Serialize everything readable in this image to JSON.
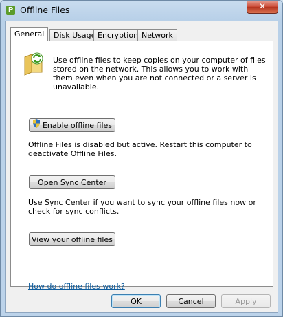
{
  "window": {
    "title": "Offline Files",
    "close_label": "✕"
  },
  "tabs": [
    {
      "label": "General",
      "active": true
    },
    {
      "label": "Disk Usage"
    },
    {
      "label": "Encryption"
    },
    {
      "label": "Network"
    }
  ],
  "general": {
    "intro_text": "Use offline files to keep copies on your computer of files stored on the network.  This allows you to work with them even when you are not connected or a server is unavailable.",
    "enable_button": "Enable offline files",
    "status_text": "Offline Files is disabled but active.  Restart this computer to deactivate Offline Files.",
    "sync_button": "Open Sync Center",
    "sync_text": "Use Sync Center if you want to sync your offline files now or check for sync conflicts.",
    "view_button": "View your offline files",
    "help_link": "How do offline files work?"
  },
  "footer": {
    "ok": "OK",
    "cancel": "Cancel",
    "apply": "Apply"
  },
  "icons": {
    "app": "offline-files-icon",
    "folder": "sync-folder-icon",
    "shield": "uac-shield-icon",
    "close": "close-icon"
  }
}
